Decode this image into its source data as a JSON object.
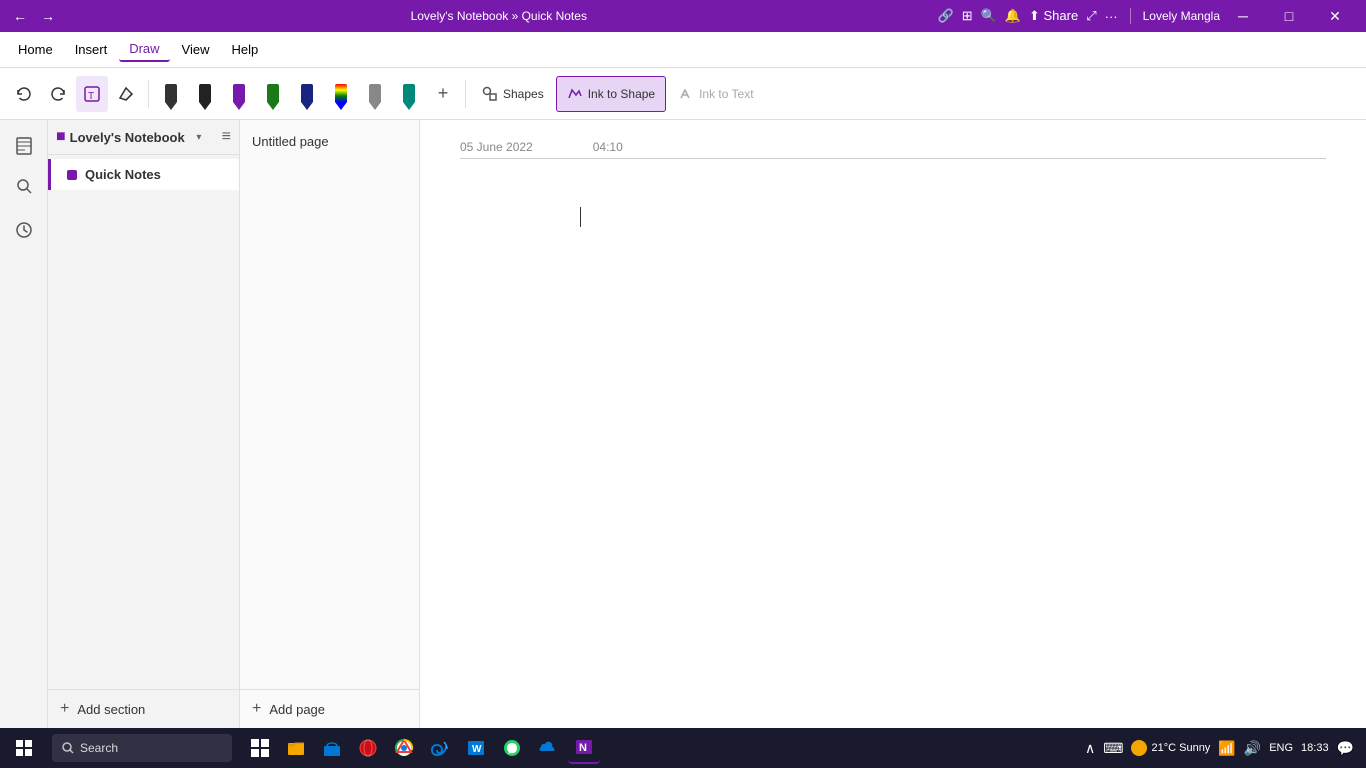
{
  "titlebar": {
    "title": "Lovely's Notebook » Quick Notes",
    "user": "Lovely Mangla",
    "nav_back": "←",
    "nav_forward": "→",
    "minimize": "─",
    "maximize": "□",
    "close": "✕"
  },
  "menubar": {
    "items": [
      "Home",
      "Insert",
      "Draw",
      "View",
      "Help"
    ],
    "active": "Draw"
  },
  "toolbar": {
    "undo_label": "↺",
    "redo_label": "↻",
    "lasso_label": "⊡",
    "eraser_label": "✕",
    "shapes_label": "Shapes",
    "ink_to_shape_label": "Ink to Shape",
    "ink_to_text_label": "Ink to Text",
    "plus_label": "+"
  },
  "notebook": {
    "name": "Lovely's Notebook",
    "sections": [
      {
        "label": "Quick Notes",
        "active": true
      }
    ],
    "add_section_label": "Add section"
  },
  "pages": {
    "items": [
      {
        "label": "Untitled page"
      }
    ],
    "add_page_label": "Add page"
  },
  "note": {
    "date": "05 June 2022",
    "time": "04:10"
  },
  "taskbar": {
    "search_placeholder": "Search",
    "weather": "21°C  Sunny",
    "language": "ENG",
    "time": "18:33"
  }
}
